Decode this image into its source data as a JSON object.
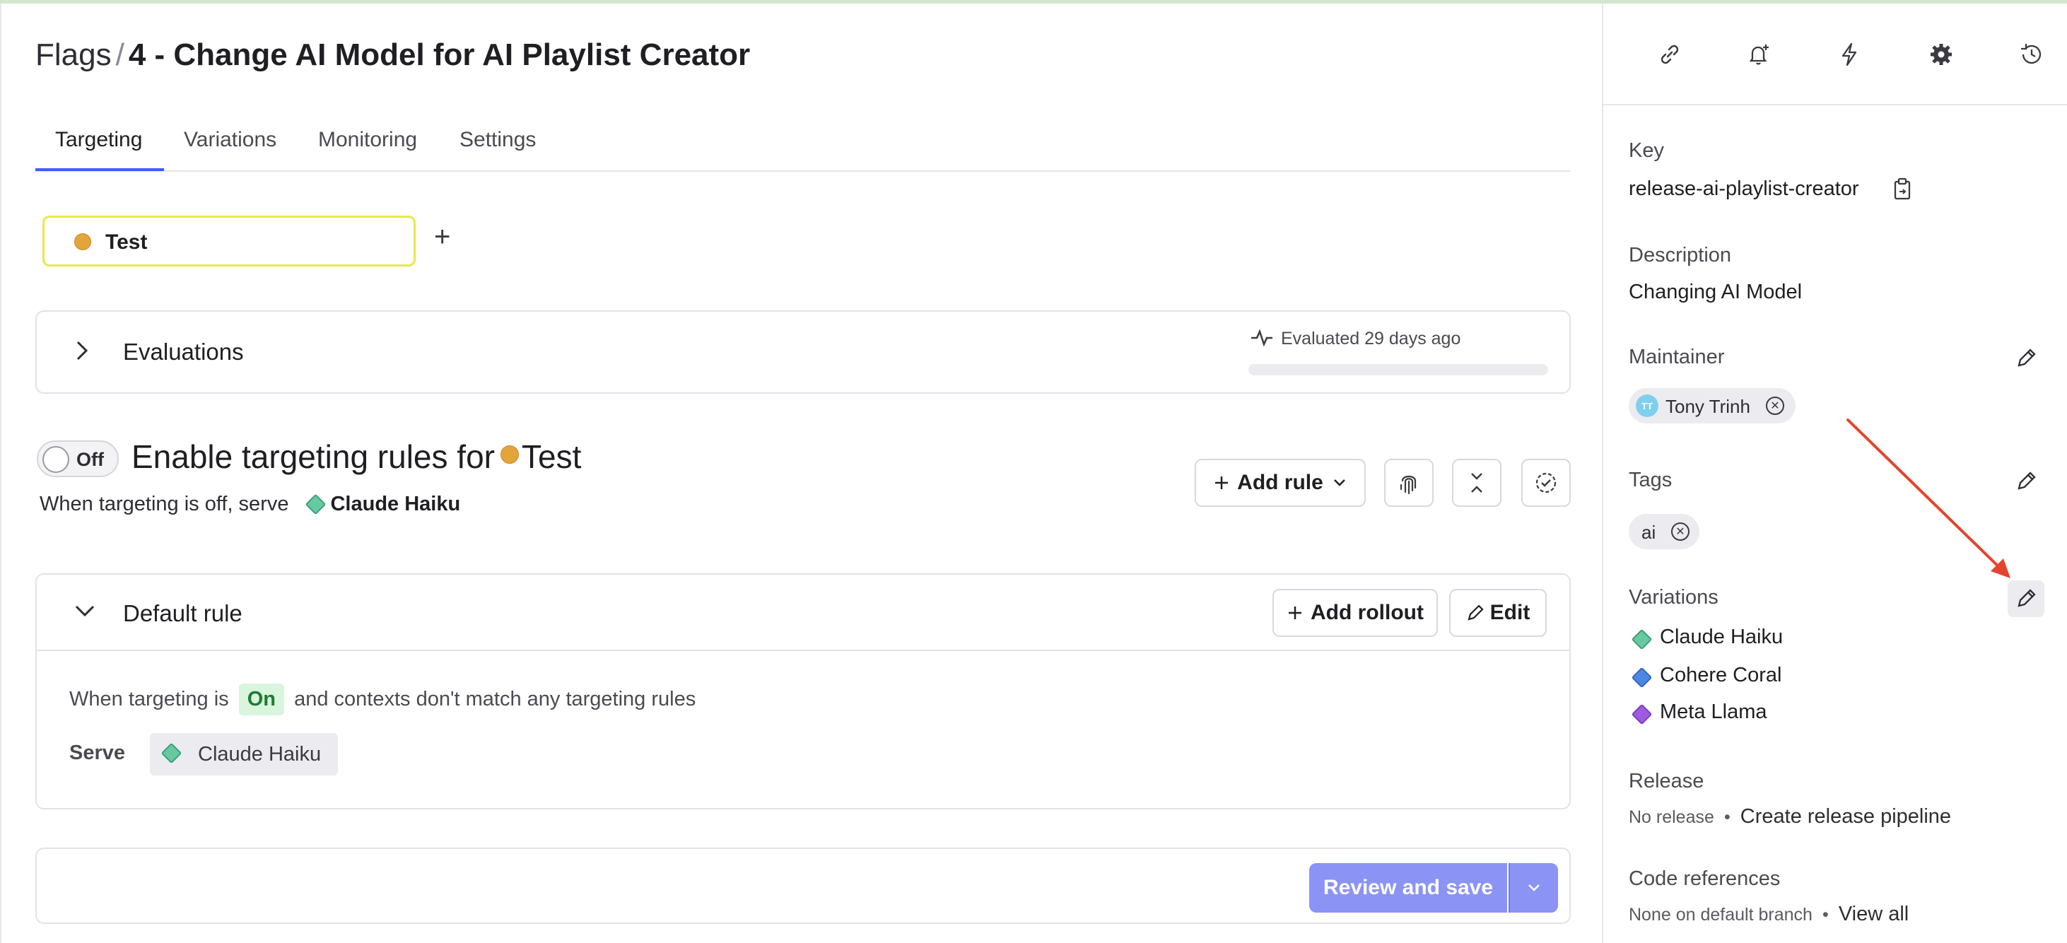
{
  "breadcrumb": {
    "root": "Flags",
    "separator": "/",
    "flag_name": "4 - Change AI Model for AI Playlist Creator"
  },
  "tabs": [
    {
      "label": "Targeting",
      "active": true
    },
    {
      "label": "Variations",
      "active": false
    },
    {
      "label": "Monitoring",
      "active": false
    },
    {
      "label": "Settings",
      "active": false
    }
  ],
  "environment": {
    "label": "Test",
    "add_symbol": "+"
  },
  "evaluations": {
    "title": "Evaluations",
    "status": "Evaluated 29 days ago"
  },
  "targeting": {
    "toggle_label": "Off",
    "title_prefix": "Enable targeting rules for",
    "environment": "Test",
    "off_serve_prefix": "When targeting is off, serve",
    "off_serve_variation": "Claude Haiku",
    "add_rule_label": "Add rule"
  },
  "default_rule": {
    "title": "Default rule",
    "add_rollout_label": "Add rollout",
    "edit_label": "Edit",
    "cond_prefix": "When targeting is",
    "cond_state": "On",
    "cond_suffix": "and contexts don't match any targeting rules",
    "serve_label": "Serve",
    "serve_variation": "Claude Haiku"
  },
  "save": {
    "review_label": "Review and save"
  },
  "sidebar": {
    "key_label": "Key",
    "key_value": "release-ai-playlist-creator",
    "description_label": "Description",
    "description_value": "Changing AI Model",
    "maintainer_label": "Maintainer",
    "maintainer_initials": "TT",
    "maintainer_name": "Tony Trinh",
    "tags_label": "Tags",
    "tags": [
      "ai"
    ],
    "variations_label": "Variations",
    "variations": [
      {
        "name": "Claude Haiku",
        "color": "#66c9a0"
      },
      {
        "name": "Cohere Coral",
        "color": "#4e86e4"
      },
      {
        "name": "Meta Llama",
        "color": "#9d5be0"
      }
    ],
    "release_label": "Release",
    "release_value": "No release",
    "release_bullet": "•",
    "release_link": "Create release pipeline",
    "coderefs_label": "Code references",
    "coderefs_value": "None on default branch",
    "coderefs_bullet": "•",
    "coderefs_link": "View all"
  },
  "colors": {
    "accent": "#405bff",
    "env_dot": "#e3a43a",
    "env_border": "#e8e94a",
    "review_button": "#8b93f5",
    "annotation_arrow": "#e5432c"
  }
}
